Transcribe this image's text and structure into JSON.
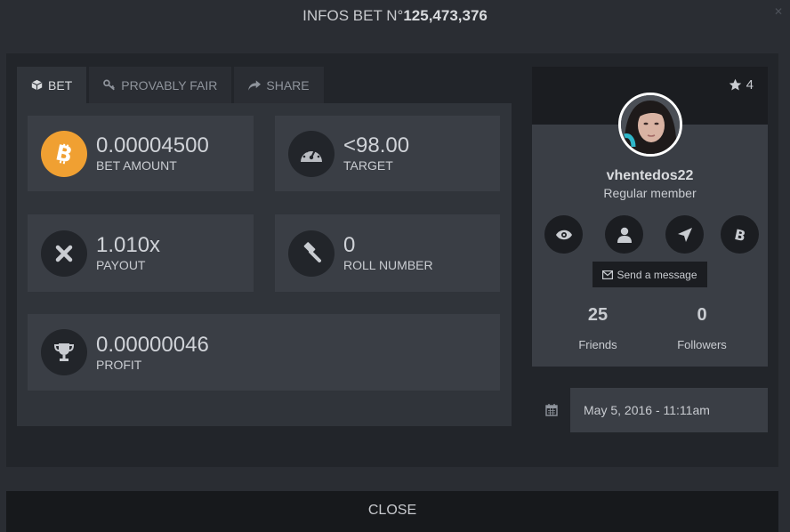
{
  "header": {
    "title_prefix": "INFOS BET N°",
    "title_number": "125,473,376"
  },
  "tabs": [
    {
      "label": "BET",
      "icon": "cube-icon"
    },
    {
      "label": "PROVABLY FAIR",
      "icon": "key-icon"
    },
    {
      "label": "SHARE",
      "icon": "share-icon"
    }
  ],
  "bet": {
    "amount": {
      "value": "0.00004500",
      "label": "BET AMOUNT",
      "icon": "bitcoin-icon"
    },
    "target": {
      "value": "<98.00",
      "label": "TARGET",
      "icon": "speedometer-icon"
    },
    "payout": {
      "value": "1.010x",
      "label": "PAYOUT",
      "icon": "times-icon"
    },
    "roll": {
      "value": "0",
      "label": "ROLL NUMBER",
      "icon": "gavel-icon"
    },
    "profit": {
      "value": "0.00000046",
      "label": "PROFIT",
      "icon": "trophy-icon"
    }
  },
  "profile": {
    "stars": "4",
    "username": "vhentedos22",
    "role": "Regular member",
    "actions": [
      "eye-icon",
      "user-icon",
      "location-arrow-icon",
      "bitcoin-icon"
    ],
    "message_label": "Send a message",
    "friends_count": "25",
    "friends_label": "Friends",
    "followers_count": "0",
    "followers_label": "Followers"
  },
  "date": "May 5, 2016 - 11:11am",
  "footer": {
    "close_label": "CLOSE"
  },
  "colors": {
    "bitcoin": "#f0a032",
    "panel": "#22252a",
    "card": "#3a3e45",
    "tabbody": "#30343a"
  }
}
